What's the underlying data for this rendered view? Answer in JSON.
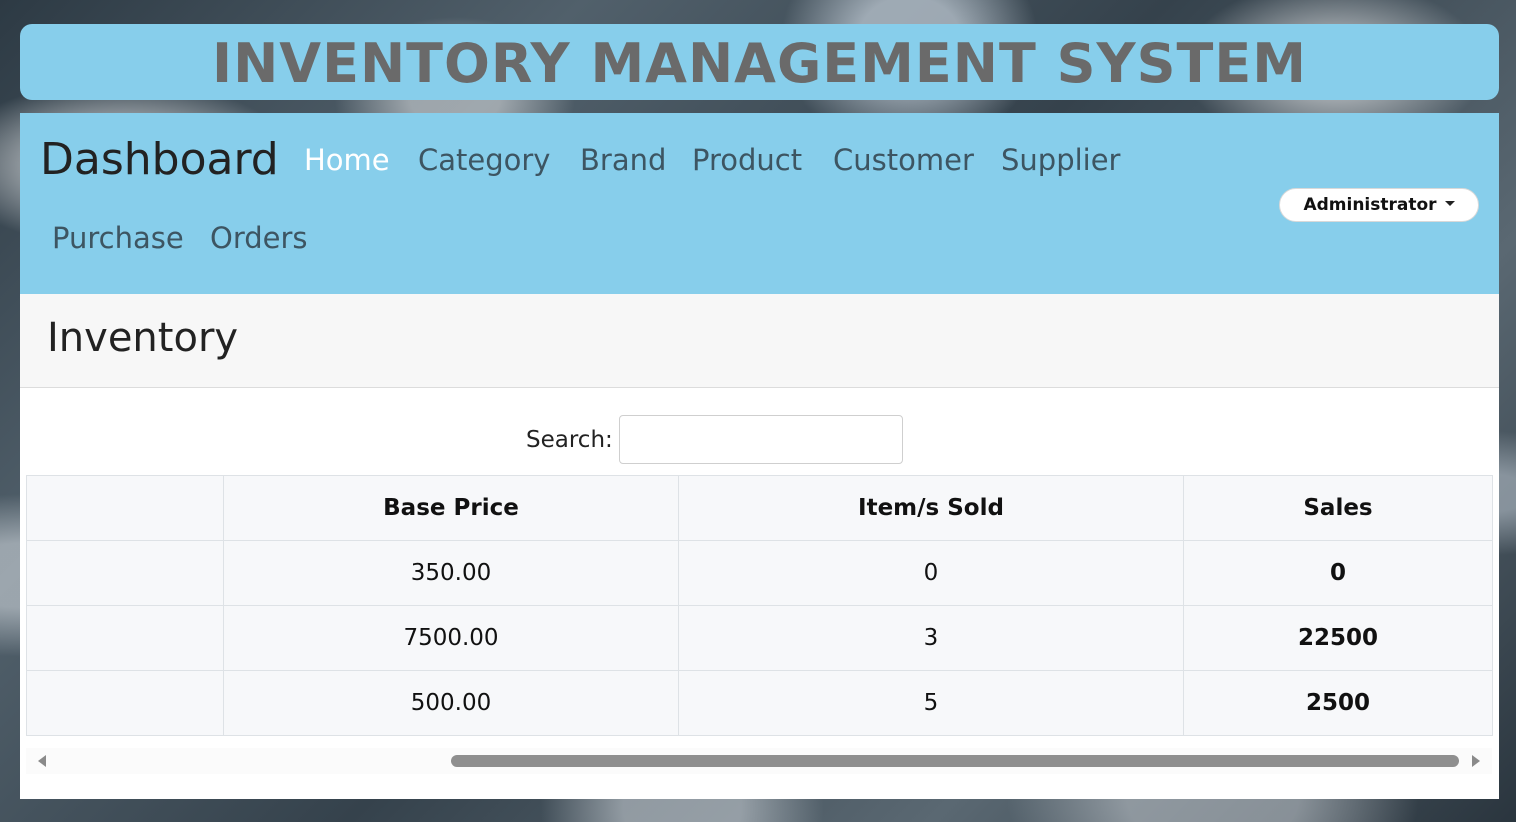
{
  "header": {
    "title": "INVENTORY MANAGEMENT SYSTEM"
  },
  "navbar": {
    "brand": "Dashboard",
    "links": [
      {
        "label": "Home",
        "active": true
      },
      {
        "label": "Category"
      },
      {
        "label": "Brand"
      },
      {
        "label": "Product"
      },
      {
        "label": "Customer"
      },
      {
        "label": "Supplier"
      },
      {
        "label": "Purchase"
      },
      {
        "label": "Orders"
      }
    ],
    "user_menu": {
      "label": "Administrator",
      "icon": "caret-down-icon"
    }
  },
  "main": {
    "card_title": "Inventory",
    "search": {
      "label": "Search:",
      "value": "",
      "placeholder": ""
    },
    "table": {
      "columns": [
        "",
        "Base Price",
        "Item/s Sold",
        "Sales"
      ],
      "rows": [
        {
          "col0": "",
          "base_price": "350.00",
          "sold": "0",
          "sales": "0"
        },
        {
          "col0": "",
          "base_price": "7500.00",
          "sold": "3",
          "sales": "22500"
        },
        {
          "col0": "",
          "base_price": "500.00",
          "sold": "5",
          "sales": "2500"
        }
      ]
    },
    "scrollbar": {
      "left_icon": "scroll-left-arrow-icon",
      "right_icon": "scroll-right-arrow-icon"
    }
  },
  "colors": {
    "accent": "#87ceeb",
    "sales_zero": "#e00000",
    "sales_positive": "#0a7a0a"
  }
}
